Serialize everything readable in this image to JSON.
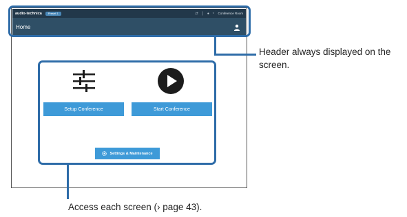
{
  "header": {
    "brand": "audio-technica",
    "badge": "Preset 1",
    "room_name": "Conference Room",
    "page_title": "Home"
  },
  "home": {
    "setup_label": "Setup Conference",
    "start_label": "Start Conference",
    "settings_label": "Settings & Maintenance"
  },
  "callouts": {
    "header_note": "Header always displayed on the screen.",
    "access_note": "Access each screen (› page 43)."
  },
  "colors": {
    "header_bg": "#2f4f66",
    "button_bg": "#3e9ad8",
    "callout_line": "#2e6ca8"
  }
}
